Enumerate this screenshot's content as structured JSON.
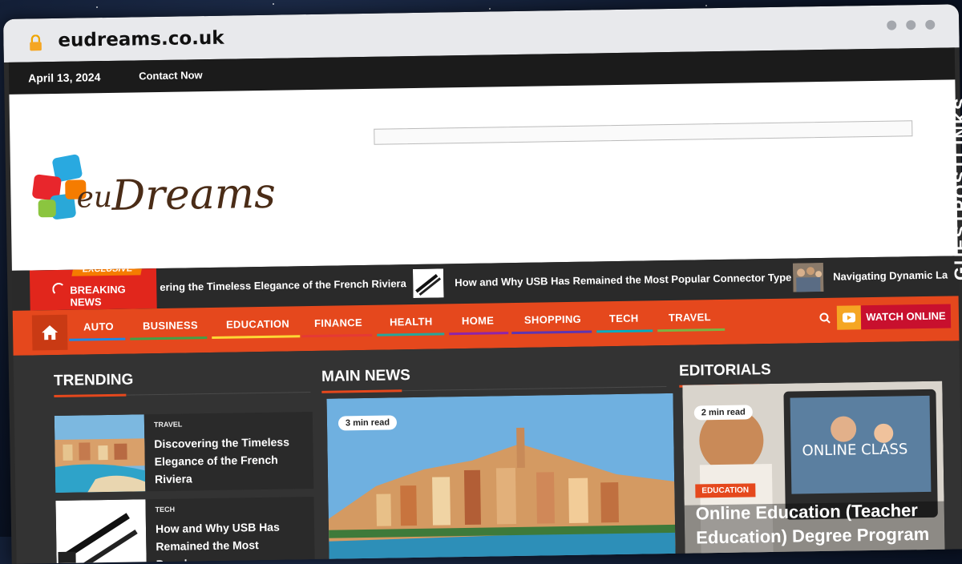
{
  "browser": {
    "url": "eudreams.co.uk"
  },
  "topbar": {
    "date": "April 13, 2024",
    "contact": "Contact Now"
  },
  "ticker": {
    "exclusive": "EXCLUSIVE",
    "breaking": "BREAKING NEWS",
    "items": [
      "ering the Timeless Elegance of the French Riviera",
      "How and Why USB Has Remained the Most Popular Connector Type",
      "Navigating Dynamic La"
    ]
  },
  "nav": {
    "items": [
      "AUTO",
      "BUSINESS",
      "EDUCATION",
      "FINANCE",
      "HEALTH",
      "HOME",
      "SHOPPING",
      "TECH",
      "TRAVEL"
    ],
    "watch": "WATCH ONLINE"
  },
  "sections": {
    "trending": "TRENDING",
    "main": "MAIN NEWS",
    "editorials": "EDITORIALS"
  },
  "trending": [
    {
      "cat": "TRAVEL",
      "title": "Discovering the Timeless Elegance of the French Riviera"
    },
    {
      "cat": "TECH",
      "title": "How and Why USB Has Remained the Most Popular"
    }
  ],
  "main_news": {
    "read": "3 min read"
  },
  "editorial": {
    "read": "2 min read",
    "cat": "EDUCATION",
    "title": "Online Education (Teacher Education) Degree Program",
    "img_text": "ONLINE CLASS"
  },
  "watermark": "GUESTPOSTLINKS",
  "colors": {
    "accent": "#e5481d",
    "breaking": "#e1261c",
    "watch": "#c8102e"
  }
}
